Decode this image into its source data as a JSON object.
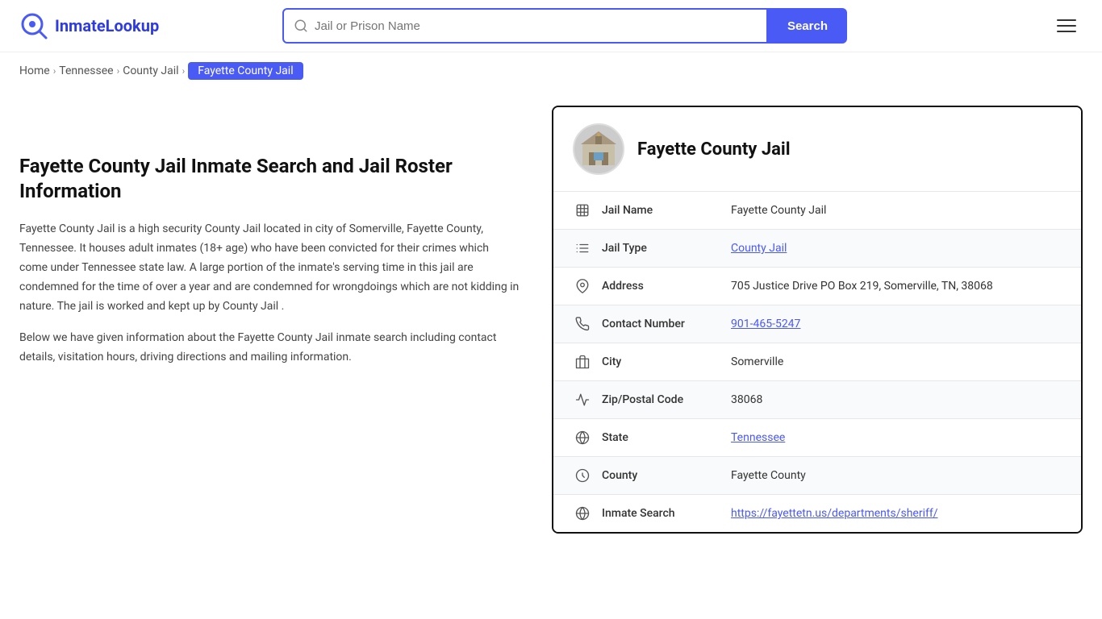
{
  "header": {
    "logo_text": "InmateLookup",
    "search_placeholder": "Jail or Prison Name",
    "search_button_label": "Search"
  },
  "breadcrumb": {
    "home": "Home",
    "state": "Tennessee",
    "type": "County Jail",
    "current": "Fayette County Jail"
  },
  "left": {
    "title": "Fayette County Jail Inmate Search and Jail Roster Information",
    "description1": "Fayette County Jail is a high security County Jail located in city of Somerville, Fayette County, Tennessee. It houses adult inmates (18+ age) who have been convicted for their crimes which come under Tennessee state law. A large portion of the inmate's serving time in this jail are condemned for the time of over a year and are condemned for wrongdoings which are not kidding in nature. The jail is worked and kept up by County Jail .",
    "description2": "Below we have given information about the Fayette County Jail inmate search including contact details, visitation hours, driving directions and mailing information."
  },
  "card": {
    "name": "Fayette County Jail",
    "rows": [
      {
        "label": "Jail Name",
        "value": "Fayette County Jail",
        "link": false,
        "icon": "jail"
      },
      {
        "label": "Jail Type",
        "value": "County Jail",
        "link": true,
        "href": "#",
        "icon": "type"
      },
      {
        "label": "Address",
        "value": "705 Justice Drive PO Box 219, Somerville, TN, 38068",
        "link": false,
        "icon": "address"
      },
      {
        "label": "Contact Number",
        "value": "901-465-5247",
        "link": true,
        "href": "tel:9014655247",
        "icon": "phone"
      },
      {
        "label": "City",
        "value": "Somerville",
        "link": false,
        "icon": "city"
      },
      {
        "label": "Zip/Postal Code",
        "value": "38068",
        "link": false,
        "icon": "zip"
      },
      {
        "label": "State",
        "value": "Tennessee",
        "link": true,
        "href": "#",
        "icon": "state"
      },
      {
        "label": "County",
        "value": "Fayette County",
        "link": false,
        "icon": "county"
      },
      {
        "label": "Inmate Search",
        "value": "https://fayettetn.us/departments/sheriff/",
        "link": true,
        "href": "https://fayettetn.us/departments/sheriff/",
        "icon": "web"
      }
    ]
  }
}
